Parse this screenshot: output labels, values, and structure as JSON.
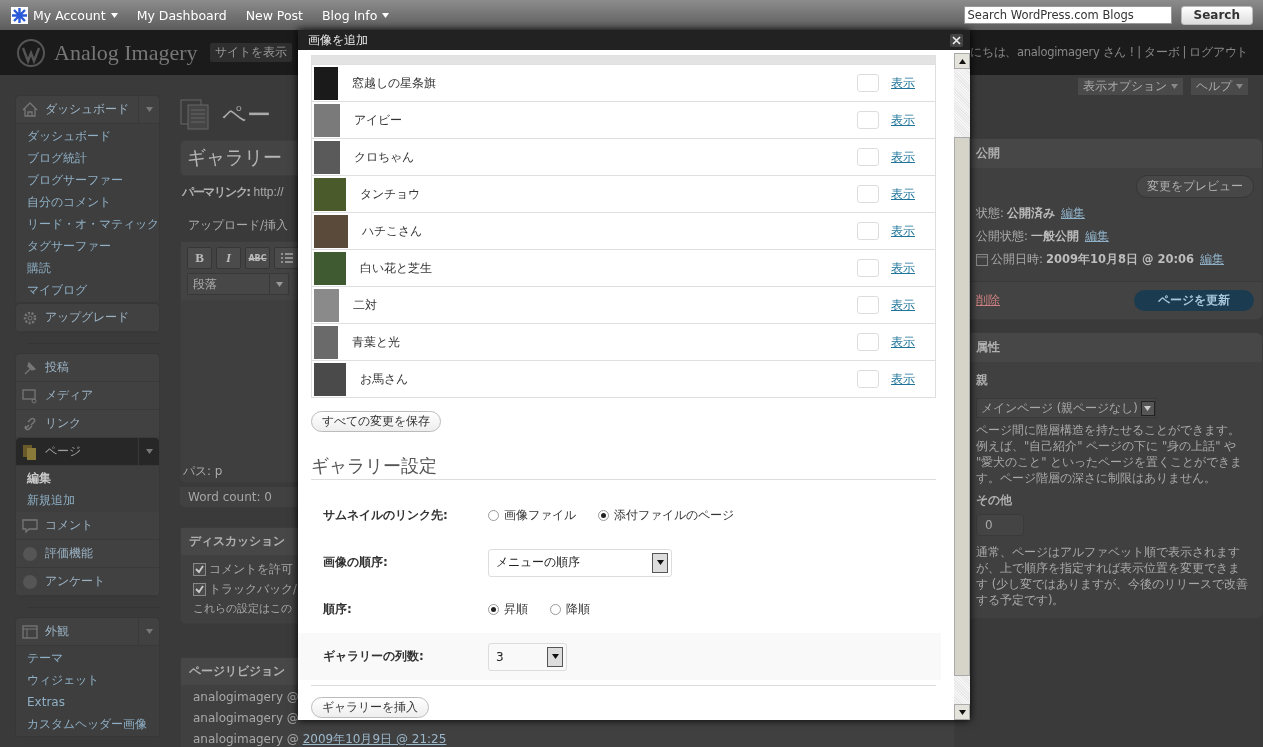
{
  "admin_bar": {
    "items": [
      {
        "label": "My Account",
        "has_menu": true
      },
      {
        "label": "My Dashboard",
        "has_menu": false
      },
      {
        "label": "New Post",
        "has_menu": false
      },
      {
        "label": "Blog Info",
        "has_menu": true
      }
    ],
    "search": {
      "placeholder": "Search WordPress.com Blogs"
    },
    "search_button": "Search"
  },
  "header": {
    "site_title": "Analog Imagery",
    "view_site": "サイトを表示",
    "greeting": "にちは、analogimagery さん ! | ターボ | ログアウト"
  },
  "screen_tabs": [
    "表示オプション",
    "ヘルプ"
  ],
  "sidebar": {
    "items": [
      {
        "kind": "menu",
        "label": "ダッシュボード",
        "selected": false,
        "expanded": true,
        "children": [
          {
            "label": "ダッシュボード",
            "selected": false
          },
          {
            "label": "ブログ統計",
            "selected": false
          },
          {
            "label": "ブログサーファー",
            "selected": false
          },
          {
            "label": "自分のコメント",
            "selected": false
          },
          {
            "label": "リード・オ・マティック",
            "selected": false
          },
          {
            "label": "タグサーファー",
            "selected": false
          },
          {
            "label": "購読",
            "selected": false
          },
          {
            "label": "マイブログ",
            "selected": false
          }
        ]
      },
      {
        "kind": "menu",
        "label": "アップグレード",
        "selected": false
      },
      {
        "kind": "separator"
      },
      {
        "kind": "menu",
        "label": "投稿",
        "selected": false
      },
      {
        "kind": "menu",
        "label": "メディア",
        "selected": false
      },
      {
        "kind": "menu",
        "label": "リンク",
        "selected": false
      },
      {
        "kind": "menu",
        "label": "ページ",
        "selected": true,
        "expanded": true,
        "children": [
          {
            "label": "編集",
            "selected": true
          },
          {
            "label": "新規追加",
            "selected": false
          }
        ]
      },
      {
        "kind": "menu",
        "label": "コメント",
        "selected": false
      },
      {
        "kind": "menu",
        "label": "評価機能",
        "selected": false
      },
      {
        "kind": "menu",
        "label": "アンケート",
        "selected": false
      },
      {
        "kind": "separator"
      },
      {
        "kind": "menu",
        "label": "外観",
        "selected": false,
        "expanded": true,
        "children": [
          {
            "label": "テーマ",
            "selected": false
          },
          {
            "label": "ウィジェット",
            "selected": false
          },
          {
            "label": "Extras",
            "selected": false
          },
          {
            "label": "カスタムヘッダー画像",
            "selected": false
          }
        ]
      }
    ]
  },
  "editor": {
    "heading": "ペー",
    "title_value": "ギャラリー",
    "permalink_label": "パーマリンク:",
    "permalink": "http://",
    "upload_label": "アップロード/挿入",
    "toolbar": [
      "B",
      "I",
      "ABC"
    ],
    "format": "段落",
    "path": "パス: p",
    "word_count": "Word count: 0",
    "discussion": {
      "title": "ディスカッション",
      "options": [
        {
          "label": "コメントを許可",
          "checked": true
        },
        {
          "label": "トラックバック/",
          "checked": true
        }
      ],
      "note": "これらの設定はこの"
    },
    "revisions": {
      "title": "ページリビジョン",
      "rows": [
        {
          "author": "analogimagery @"
        },
        {
          "author": "analogimagery @"
        },
        {
          "author": "analogimagery @",
          "date": "2009年10月9日 @ 21:25"
        }
      ]
    }
  },
  "publish": {
    "title": "公開",
    "preview_button": "変更をプレビュー",
    "rows": [
      {
        "label": "状態:",
        "value": "公開済み",
        "link": "編集"
      },
      {
        "label": "公開状態:",
        "value": "一般公開",
        "link": "編集"
      },
      {
        "label": "公開日時:",
        "value": "2009年10月8日 @ 20:06",
        "link": "編集"
      }
    ],
    "delete": "削除",
    "update_button": "ページを更新"
  },
  "attributes": {
    "title": "属性",
    "parent_label": "親",
    "parent_value": "メインページ (親ページなし)",
    "parent_help": "ページ間に階層構造を持たせることができます。例えば、\"自己紹介\" ページの下に \"身の上話\" や \"愛犬のこと\" といったページを置くことができます。ページ階層の深さに制限はありません。",
    "order_label": "その他",
    "order_value": "0",
    "order_help": "通常、ページはアルファベット順で表示されますが、上で順序を指定すれば表示位置を変更できます (少し変ではありますが、今後のリリースで改善する予定です)。"
  },
  "modal": {
    "title": "画像を追加",
    "images": [
      {
        "title": "窓越しの星条旗",
        "link": "表示"
      },
      {
        "title": "アイビー",
        "link": "表示"
      },
      {
        "title": "クロちゃん",
        "link": "表示"
      },
      {
        "title": "タンチョウ",
        "link": "表示"
      },
      {
        "title": "ハチこさん",
        "link": "表示"
      },
      {
        "title": "白い花と芝生",
        "link": "表示"
      },
      {
        "title": "二対",
        "link": "表示"
      },
      {
        "title": "青葉と光",
        "link": "表示"
      },
      {
        "title": "お馬さん",
        "link": "表示"
      }
    ],
    "save_button": "すべての変更を保存",
    "gallery_heading": "ギャラリー設定",
    "settings": [
      {
        "kind": "radio",
        "label": "サムネイルのリンク先:",
        "options": [
          {
            "label": "画像ファイル",
            "selected": false
          },
          {
            "label": "添付ファイルのページ",
            "selected": true
          }
        ]
      },
      {
        "kind": "select",
        "label": "画像の順序:",
        "value": "メニューの順序"
      },
      {
        "kind": "radio",
        "label": "順序:",
        "options": [
          {
            "label": "昇順",
            "selected": true
          },
          {
            "label": "降順",
            "selected": false
          }
        ]
      },
      {
        "kind": "select",
        "label": "ギャラリーの列数:",
        "value": "3"
      }
    ],
    "insert_button": "ギャラリーを挿入"
  }
}
